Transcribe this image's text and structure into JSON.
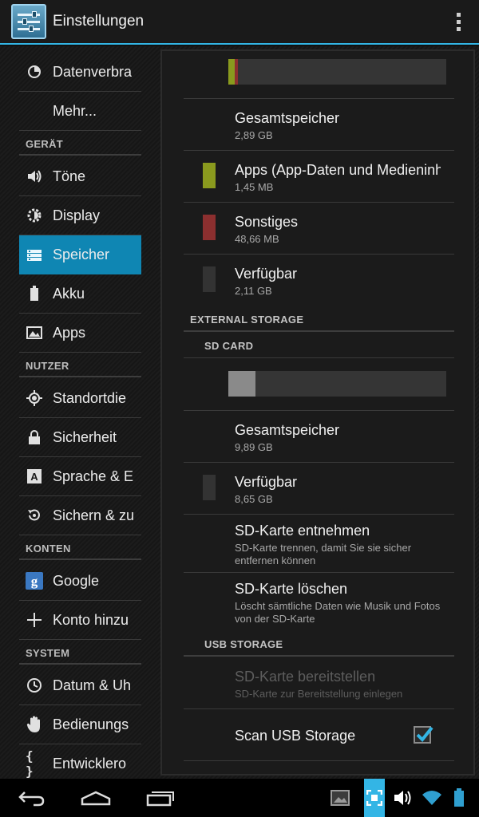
{
  "app": {
    "title": "Einstellungen"
  },
  "sidebar": {
    "items": [
      {
        "label": "Datenverbra",
        "icon": "pie-chart-icon"
      },
      {
        "label": "Mehr...",
        "icon": ""
      },
      {
        "label": "Töne",
        "icon": "volume-icon"
      },
      {
        "label": "Display",
        "icon": "brightness-icon"
      },
      {
        "label": "Speicher",
        "icon": "storage-icon",
        "selected": true
      },
      {
        "label": "Akku",
        "icon": "battery-icon"
      },
      {
        "label": "Apps",
        "icon": "apps-icon"
      },
      {
        "label": "Standortdie",
        "icon": "location-icon"
      },
      {
        "label": "Sicherheit",
        "icon": "lock-icon"
      },
      {
        "label": "Sprache & E",
        "icon": "language-icon"
      },
      {
        "label": "Sichern & zu",
        "icon": "backup-icon"
      },
      {
        "label": "Google",
        "icon": "google-icon"
      },
      {
        "label": "Konto hinzu",
        "icon": "add-icon"
      },
      {
        "label": "Datum & Uh",
        "icon": "clock-icon"
      },
      {
        "label": "Bedienungs",
        "icon": "hand-icon"
      },
      {
        "label": "Entwicklero",
        "icon": "braces-icon"
      }
    ],
    "headers": [
      "GERÄT",
      "NUTZER",
      "KONTEN",
      "SYSTEM"
    ]
  },
  "internal": {
    "usage": {
      "apps_fraction": 0.03,
      "other_fraction": 0.015
    },
    "total": {
      "title": "Gesamtspeicher",
      "value": "2,89 GB"
    },
    "apps": {
      "title": "Apps (App-Daten und Medieninh",
      "value": "1,45 MB",
      "color": "#8a9a1e"
    },
    "other": {
      "title": "Sonstiges",
      "value": "48,66 MB",
      "color": "#8c2f2f"
    },
    "free": {
      "title": "Verfügbar",
      "value": "2,11 GB",
      "color": "#333333"
    }
  },
  "external": {
    "header": "EXTERNAL STORAGE",
    "sd_header": "SD CARD",
    "usage": {
      "used_fraction": 0.125
    },
    "total": {
      "title": "Gesamtspeicher",
      "value": "9,89 GB"
    },
    "free": {
      "title": "Verfügbar",
      "value": "8,65 GB"
    },
    "unmount": {
      "title": "SD-Karte entnehmen",
      "summary": "SD-Karte trennen, damit Sie sie sicher entfernen können"
    },
    "erase": {
      "title": "SD-Karte löschen",
      "summary": "Löscht sämtliche Daten wie Musik und Fotos von der SD-Karte"
    }
  },
  "usb": {
    "header": "USB STORAGE",
    "mount": {
      "title": "SD-Karte bereitstellen",
      "summary": "SD-Karte zur Bereitstellung einlegen"
    },
    "scan": {
      "title": "Scan USB Storage",
      "checked": true
    }
  },
  "colors": {
    "accent": "#33b5e5",
    "selected": "#0f86b3"
  }
}
